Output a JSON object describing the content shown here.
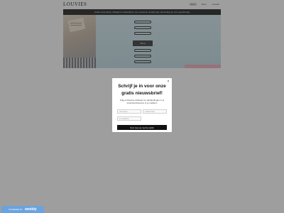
{
  "header": {
    "logo": "LOUVIES",
    "nav": [
      "Home",
      "Shop",
      "Contact"
    ],
    "active_nav": "Home"
  },
  "announcement": "Gratis verzending in België en Nederland, voor overal ter wereld vrije verzending op onze geschenkje",
  "hero": {
    "button_label": "Shop"
  },
  "modal": {
    "close_symbol": "×",
    "title": "Schrijf je in voor onze gratis nieuwsbrief!",
    "description": "Krijg exclusieve artikelen en aanbiedingen in je shop/berichtenbox in je mailbox!",
    "first_name_placeholder": "Voornaam",
    "last_name_placeholder": "Achternaam",
    "email_placeholder": "E-mailadres",
    "submit_label": "Kom mee op met de mails!"
  },
  "badge": {
    "prefix": "POWERED BY",
    "brand": "weebly"
  },
  "colors": {
    "overlay": "#00000061",
    "announcement_bg": "#3f3f3f",
    "submit_bg": "#111111",
    "badge_bg": "#6aa3e0",
    "accent_pink": "#f3b8c6"
  }
}
